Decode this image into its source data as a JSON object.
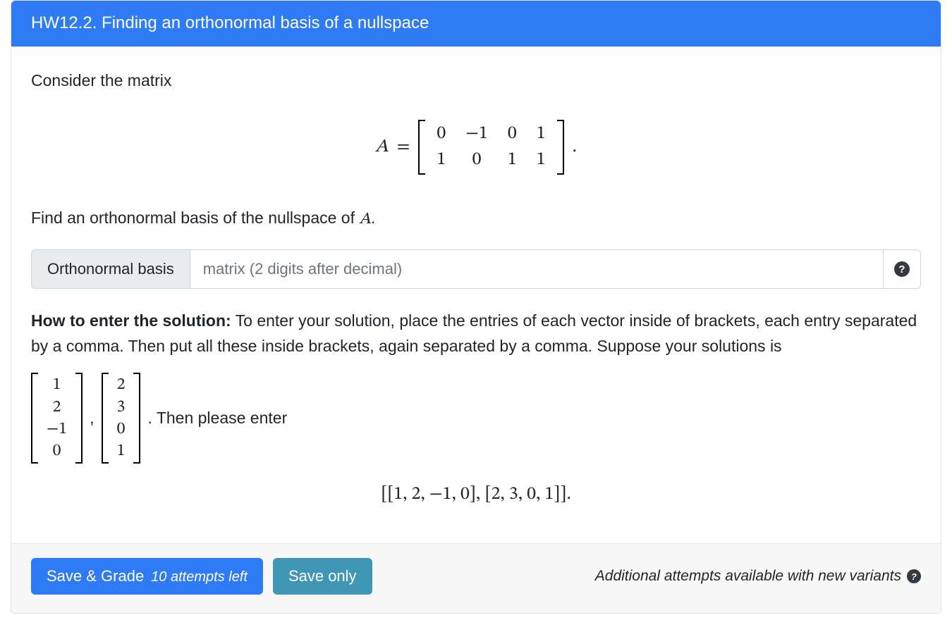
{
  "header": {
    "title": "HW12.2. Finding an orthonormal basis of a nullspace"
  },
  "body": {
    "intro": "Consider the matrix",
    "matrix_symbol": "A",
    "equals": "=",
    "matrix_A": {
      "rows": [
        [
          "0",
          "−1",
          "0",
          "1"
        ],
        [
          "1",
          "0",
          "1",
          "1"
        ]
      ],
      "trailing_period": "."
    },
    "find_line_pre": "Find an orthonormal basis of the nullspace of ",
    "find_line_symbol": "A",
    "find_line_post": ".",
    "input": {
      "label": "Orthonormal basis",
      "placeholder": "matrix (2 digits after decimal)",
      "value": "",
      "help_symbol": "?"
    },
    "instructions": {
      "bold": "How to enter the solution:",
      "text": " To enter your solution, place the entries of each vector inside of brackets, each entry separated by a comma. Then put all these inside brackets, again separated by a comma. Suppose your solutions is ",
      "example_vectors": {
        "v1": [
          "1",
          "2",
          "−1",
          "0"
        ],
        "v2": [
          "2",
          "3",
          "0",
          "1"
        ],
        "separator": ",",
        "after": ". Then please enter"
      },
      "example_entry": "[[1, 2, −1, 0], [2, 3, 0, 1]]."
    }
  },
  "footer": {
    "save_grade_label": "Save & Grade",
    "attempts_left": "10 attempts left",
    "save_only_label": "Save only",
    "additional": "Additional attempts available with new variants",
    "help_symbol": "?"
  }
}
